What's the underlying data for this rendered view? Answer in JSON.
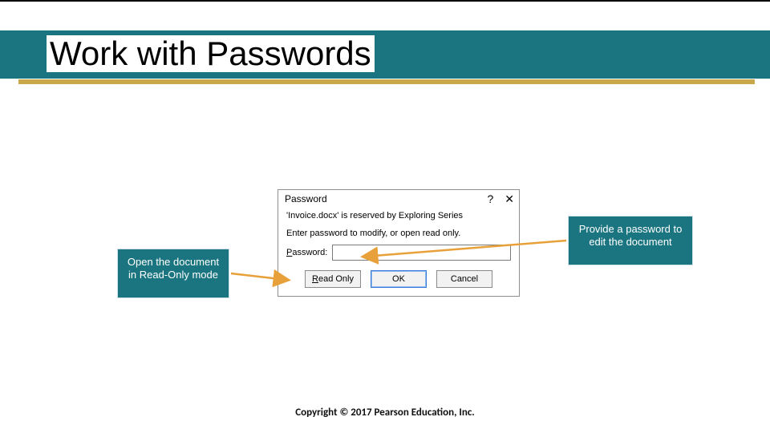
{
  "slide": {
    "title": "Work with Passwords",
    "footer": "Copyright © 2017 Pearson Education, Inc."
  },
  "dialog": {
    "title": "Password",
    "reserved_text": "'Invoice.docx' is reserved by Exploring Series",
    "instruction": "Enter password to modify, or open read only.",
    "password_label": "Password:",
    "password_value": "",
    "buttons": {
      "read_only": "Read Only",
      "ok": "OK",
      "cancel": "Cancel"
    }
  },
  "callouts": {
    "left": "Open the document in Read-Only mode",
    "right": "Provide a password to edit the document"
  }
}
